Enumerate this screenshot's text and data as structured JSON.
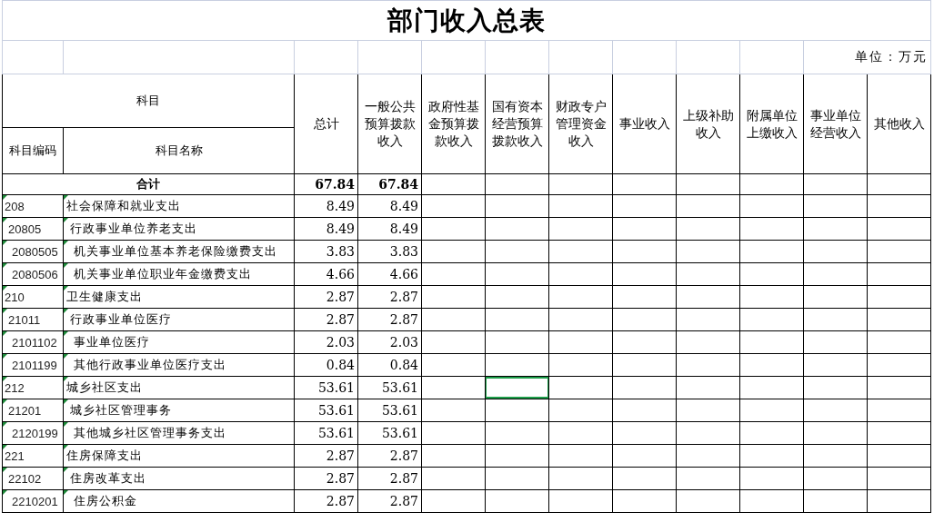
{
  "title": "部门收入总表",
  "unit": "单位：万元",
  "subject_header": "科目",
  "code_header": "科目编码",
  "name_header": "科目名称",
  "columns": [
    "总计",
    "一般公共预算拨款收入",
    "政府性基金预算拨款收入",
    "国有资本经营预算拨款收入",
    "财政专户管理资金收入",
    "事业收入",
    "上级补助收入",
    "附属单位上缴收入",
    "事业单位经营收入",
    "其他收入"
  ],
  "total": {
    "label": "合计",
    "values": [
      "67.84",
      "67.84"
    ]
  },
  "rows": [
    {
      "code": "208",
      "name": "社会保障和就业支出",
      "values": [
        "8.49",
        "8.49"
      ],
      "cells": [
        {
          "selected": false
        },
        {
          "selected": false
        },
        {
          "selected": false
        },
        {
          "selected": false
        },
        {
          "selected": false
        },
        {
          "selected": false
        },
        {
          "selected": false
        },
        {
          "selected": false
        }
      ],
      "children": [
        {
          "code": "20805",
          "name": "行政事业单位养老支出",
          "values": [
            "8.49",
            "8.49"
          ],
          "cells": [
            {
              "selected": false
            },
            {
              "selected": false
            },
            {
              "selected": false
            },
            {
              "selected": false
            },
            {
              "selected": false
            },
            {
              "selected": false
            },
            {
              "selected": false
            },
            {
              "selected": false
            }
          ],
          "children": [
            {
              "code": "2080505",
              "name": "机关事业单位基本养老保险缴费支出",
              "values": [
                "3.83",
                "3.83"
              ],
              "cells": [
                {
                  "selected": false
                },
                {
                  "selected": false
                },
                {
                  "selected": false
                },
                {
                  "selected": false
                },
                {
                  "selected": false
                },
                {
                  "selected": false
                },
                {
                  "selected": false
                },
                {
                  "selected": false
                }
              ]
            },
            {
              "code": "2080506",
              "name": "机关事业单位职业年金缴费支出",
              "values": [
                "4.66",
                "4.66"
              ],
              "cells": [
                {
                  "selected": false
                },
                {
                  "selected": false
                },
                {
                  "selected": false
                },
                {
                  "selected": false
                },
                {
                  "selected": false
                },
                {
                  "selected": false
                },
                {
                  "selected": false
                },
                {
                  "selected": false
                }
              ]
            }
          ]
        }
      ]
    },
    {
      "code": "210",
      "name": "卫生健康支出",
      "values": [
        "2.87",
        "2.87"
      ],
      "cells": [
        {
          "selected": false
        },
        {
          "selected": false
        },
        {
          "selected": false
        },
        {
          "selected": false
        },
        {
          "selected": false
        },
        {
          "selected": false
        },
        {
          "selected": false
        },
        {
          "selected": false
        }
      ],
      "children": [
        {
          "code": "21011",
          "name": "行政事业单位医疗",
          "values": [
            "2.87",
            "2.87"
          ],
          "cells": [
            {
              "selected": false
            },
            {
              "selected": false
            },
            {
              "selected": false
            },
            {
              "selected": false
            },
            {
              "selected": false
            },
            {
              "selected": false
            },
            {
              "selected": false
            },
            {
              "selected": false
            }
          ],
          "children": [
            {
              "code": "2101102",
              "name": "事业单位医疗",
              "values": [
                "2.03",
                "2.03"
              ],
              "cells": [
                {
                  "selected": false
                },
                {
                  "selected": false
                },
                {
                  "selected": false
                },
                {
                  "selected": false
                },
                {
                  "selected": false
                },
                {
                  "selected": false
                },
                {
                  "selected": false
                },
                {
                  "selected": false
                }
              ]
            },
            {
              "code": "2101199",
              "name": "其他行政事业单位医疗支出",
              "values": [
                "0.84",
                "0.84"
              ],
              "cells": [
                {
                  "selected": false
                },
                {
                  "selected": false
                },
                {
                  "selected": false
                },
                {
                  "selected": false
                },
                {
                  "selected": false
                },
                {
                  "selected": false
                },
                {
                  "selected": false
                },
                {
                  "selected": false
                }
              ]
            }
          ]
        }
      ]
    },
    {
      "code": "212",
      "name": "城乡社区支出",
      "values": [
        "53.61",
        "53.61"
      ],
      "cells": [
        {
          "selected": false
        },
        {
          "selected": true
        },
        {
          "selected": false
        },
        {
          "selected": false
        },
        {
          "selected": false
        },
        {
          "selected": false
        },
        {
          "selected": false
        },
        {
          "selected": false
        }
      ],
      "children": [
        {
          "code": "21201",
          "name": "城乡社区管理事务",
          "values": [
            "53.61",
            "53.61"
          ],
          "cells": [
            {
              "selected": false
            },
            {
              "selected": false
            },
            {
              "selected": false
            },
            {
              "selected": false
            },
            {
              "selected": false
            },
            {
              "selected": false
            },
            {
              "selected": false
            },
            {
              "selected": false
            }
          ],
          "children": [
            {
              "code": "2120199",
              "name": "其他城乡社区管理事务支出",
              "values": [
                "53.61",
                "53.61"
              ],
              "cells": [
                {
                  "selected": false
                },
                {
                  "selected": false
                },
                {
                  "selected": false
                },
                {
                  "selected": false
                },
                {
                  "selected": false
                },
                {
                  "selected": false
                },
                {
                  "selected": false
                },
                {
                  "selected": false
                }
              ]
            }
          ]
        }
      ]
    },
    {
      "code": "221",
      "name": "住房保障支出",
      "values": [
        "2.87",
        "2.87"
      ],
      "cells": [
        {
          "selected": false
        },
        {
          "selected": false
        },
        {
          "selected": false
        },
        {
          "selected": false
        },
        {
          "selected": false
        },
        {
          "selected": false
        },
        {
          "selected": false
        },
        {
          "selected": false
        }
      ],
      "children": [
        {
          "code": "22102",
          "name": "住房改革支出",
          "values": [
            "2.87",
            "2.87"
          ],
          "cells": [
            {
              "selected": false
            },
            {
              "selected": false
            },
            {
              "selected": false
            },
            {
              "selected": false
            },
            {
              "selected": false
            },
            {
              "selected": false
            },
            {
              "selected": false
            },
            {
              "selected": false
            }
          ],
          "children": [
            {
              "code": "2210201",
              "name": "住房公积金",
              "values": [
                "2.87",
                "2.87"
              ],
              "cells": [
                {
                  "selected": false
                },
                {
                  "selected": false
                },
                {
                  "selected": false
                },
                {
                  "selected": false
                },
                {
                  "selected": false
                },
                {
                  "selected": false
                },
                {
                  "selected": false
                },
                {
                  "selected": false
                }
              ]
            }
          ]
        }
      ]
    }
  ]
}
